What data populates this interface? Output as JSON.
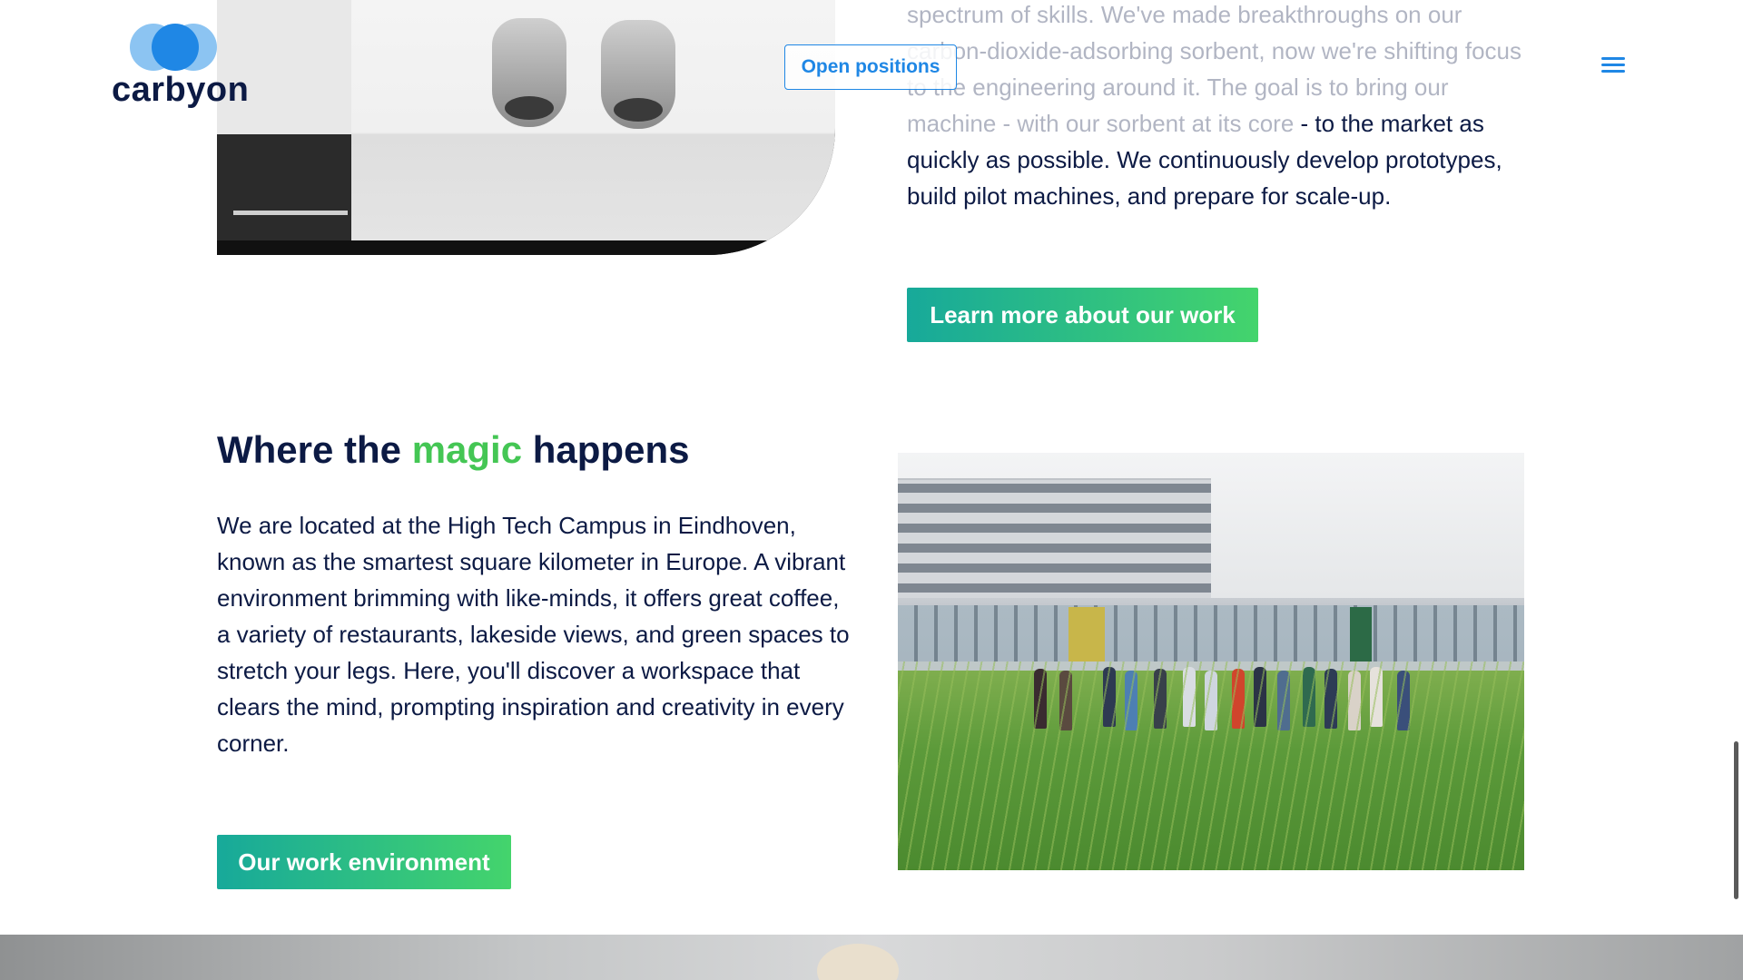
{
  "brand": {
    "logo_text": "carbyon"
  },
  "header": {
    "open_positions_label": "Open positions",
    "menu_icon": "hamburger-menu-icon"
  },
  "work_section": {
    "intro_faded": "spectrum of skills. We've made breakthroughs on our carbon-dioxide-adsorbing sorbent, now we're shifting focus to the engineering around it. The goal is to bring our machine - with our sorbent at its core",
    "intro_visible": "- to the market as quickly as possible. We continuously develop prototypes, build pilot machines, and prepare for scale-up.",
    "cta_label": "Learn more about our work"
  },
  "magic_section": {
    "title_before": "Where the ",
    "title_accent": "magic",
    "title_after": " happens",
    "body": "We are located at the High Tech Campus in Eindhoven, known as the smartest square kilometer in Europe. A vibrant environment brimming with like-minds, it offers great coffee, a variety of restaurants, lakeside views, and green spaces to stretch your legs. Here, you'll discover a workspace that clears the mind, prompting inspiration and creativity in every corner.",
    "cta_label": "Our work environment"
  },
  "colors": {
    "navy": "#0c1a44",
    "brand_blue": "#1f87e5",
    "accent_green": "#44c654",
    "button_gradient_start": "#17a99a",
    "button_gradient_end": "#44d46c"
  }
}
